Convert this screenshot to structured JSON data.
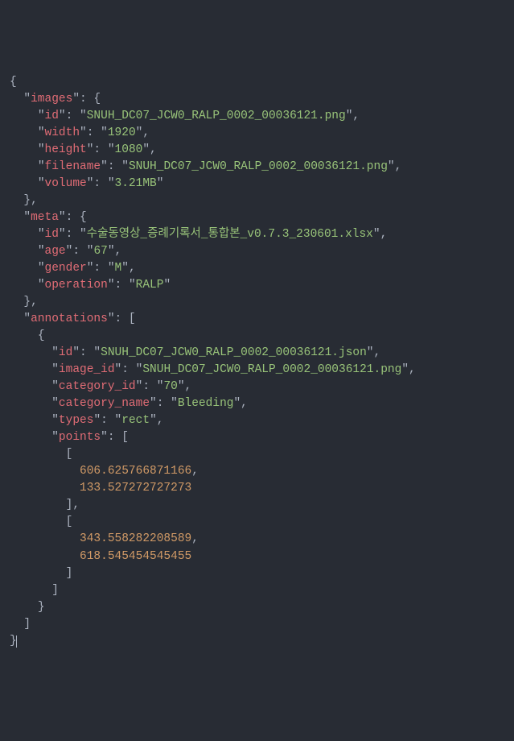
{
  "code": {
    "images": {
      "id": "SNUH_DC07_JCW0_RALP_0002_00036121.png",
      "width": "1920",
      "height": "1080",
      "filename": "SNUH_DC07_JCW0_RALP_0002_00036121.png",
      "volume": "3.21MB"
    },
    "meta": {
      "id": "수술동영상_증례기록서_통합본_v0.7.3_230601.xlsx",
      "age": "67",
      "gender": "M",
      "operation": "RALP"
    },
    "annotations": [
      {
        "id": "SNUH_DC07_JCW0_RALP_0002_00036121.json",
        "image_id": "SNUH_DC07_JCW0_RALP_0002_00036121.png",
        "category_id": "70",
        "category_name": "Bleeding",
        "types": "rect",
        "points": [
          [
            606.625766871166,
            133.527272727273
          ],
          [
            343.558282208589,
            618.545454545455
          ]
        ]
      }
    ]
  },
  "keys": {
    "images": "images",
    "id": "id",
    "width": "width",
    "height": "height",
    "filename": "filename",
    "volume": "volume",
    "meta": "meta",
    "age": "age",
    "gender": "gender",
    "operation": "operation",
    "annotations": "annotations",
    "image_id": "image_id",
    "category_id": "category_id",
    "category_name": "category_name",
    "types": "types",
    "points": "points"
  }
}
